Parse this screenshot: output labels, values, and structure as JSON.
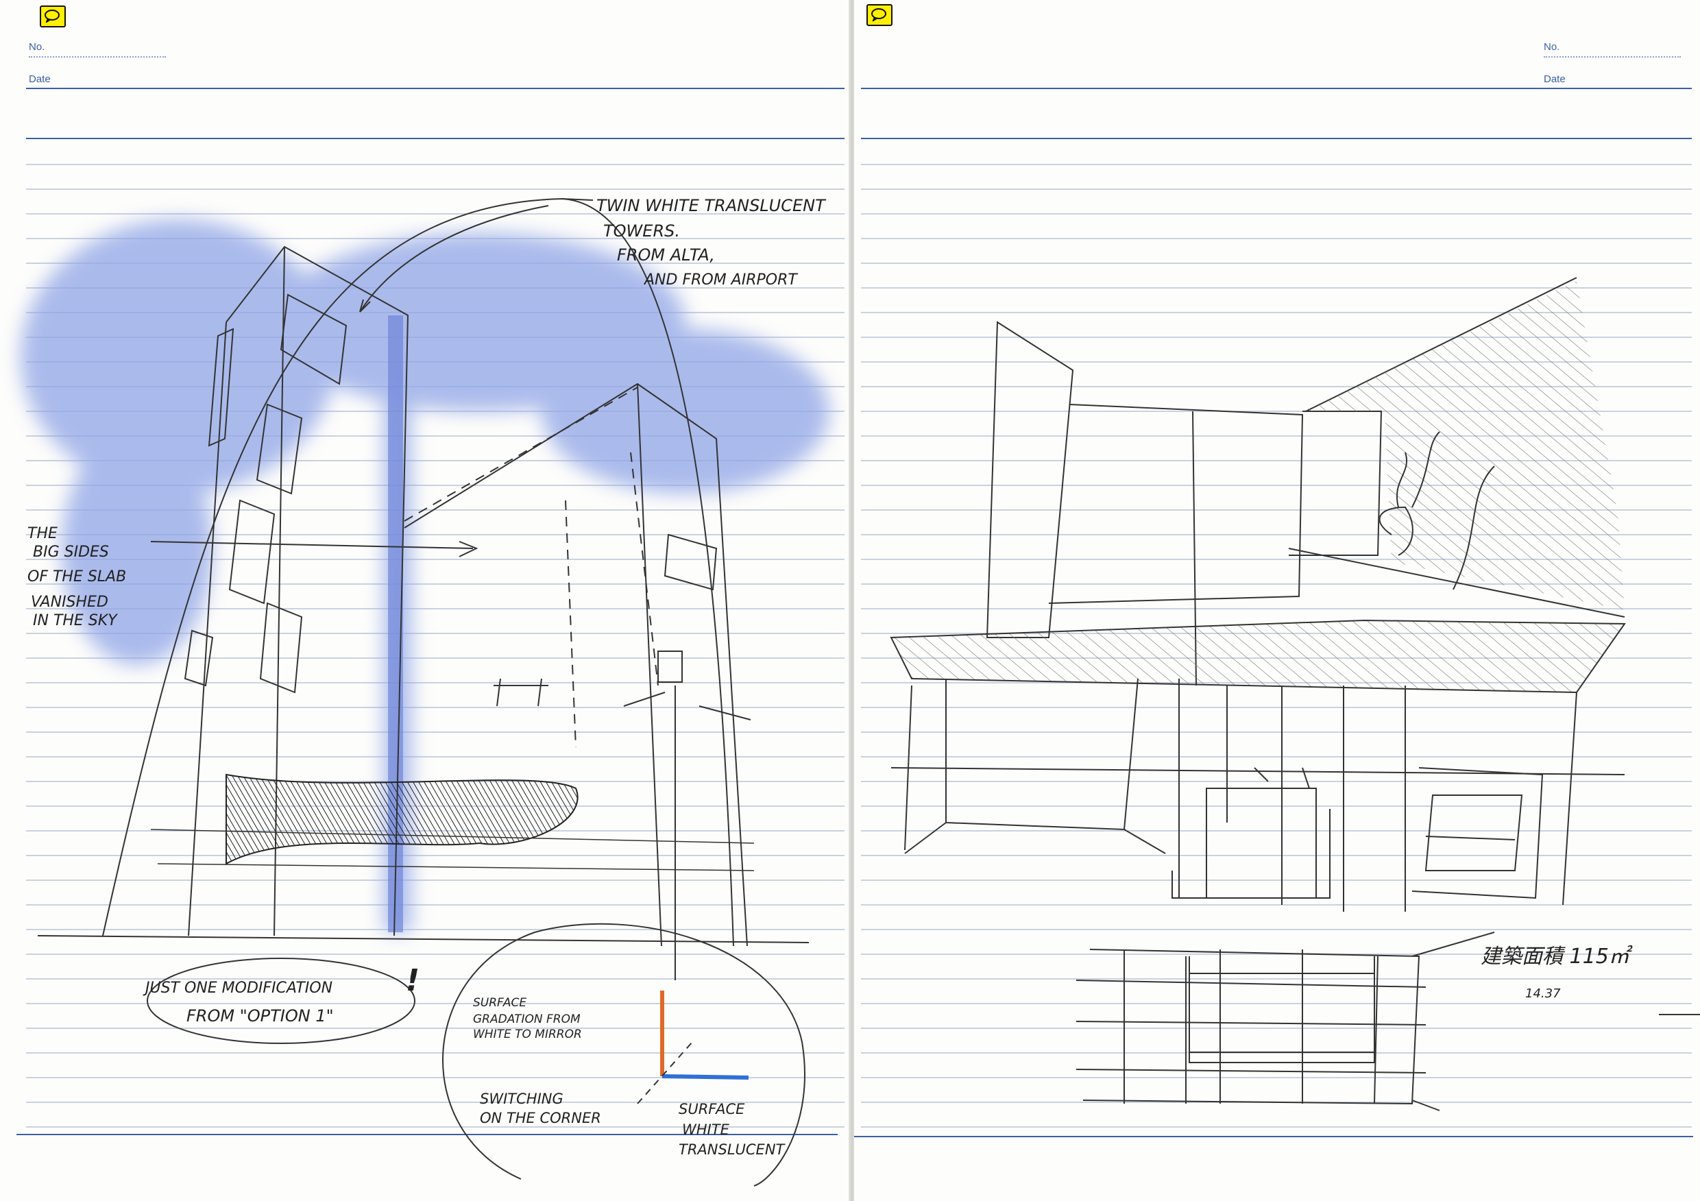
{
  "left_page": {
    "no_label": "No.",
    "date_label": "Date",
    "annotations": {
      "twin_towers_1": "TWIN WHITE TRANSLUCENT",
      "twin_towers_2": "TOWERS.",
      "twin_towers_3": "FROM ALTA,",
      "twin_towers_4": "AND FROM AIRPORT",
      "big_sides_1": "THE",
      "big_sides_2": "BIG SIDES",
      "big_sides_3": "OF THE SLAB",
      "big_sides_4": "VANISHED",
      "big_sides_5": "IN THE SKY",
      "modification_1": "JUST ONE MODIFICATION",
      "modification_2": "FROM \"OPTION 1\"",
      "exclaim": "!",
      "surface_grad_1": "SURFACE",
      "surface_grad_2": "GRADATION FROM",
      "surface_grad_3": "WHITE TO MIRROR",
      "switching_1": "SWITCHING",
      "switching_2": "ON THE CORNER",
      "surface_white_1": "SURFACE",
      "surface_white_2": "WHITE",
      "surface_white_3": "TRANSLUCENT"
    }
  },
  "right_page": {
    "no_label": "No.",
    "date_label": "Date",
    "annotations": {
      "area_note": "建築面積 115㎡",
      "area_sub": "14.37"
    }
  },
  "colors": {
    "rule_line": "#b9c3d6",
    "header_rule": "#3a5fa8",
    "sky_blue": "#8fa4e6",
    "ink": "#222222",
    "note_icon": "#ffef00",
    "orange_mark": "#e0692a",
    "blue_mark": "#2f6fd8"
  },
  "icons": {
    "comment": "speech-bubble-icon"
  }
}
